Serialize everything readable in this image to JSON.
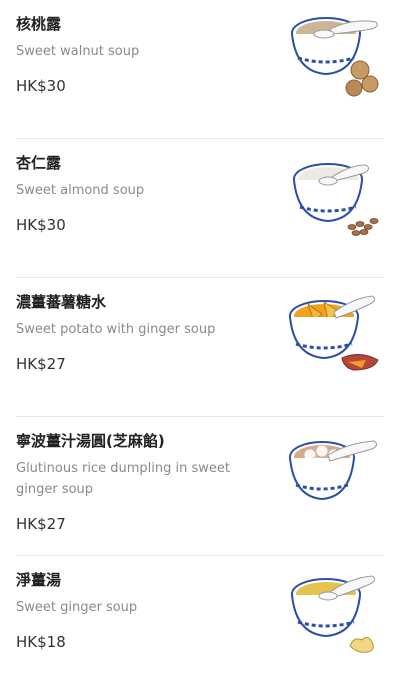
{
  "menu": {
    "items": [
      {
        "name": "核桃露",
        "desc": "Sweet walnut soup",
        "price": "HK$30",
        "soup_color": "#cdb696",
        "garnish": "walnut-icon"
      },
      {
        "name": "杏仁露",
        "desc": "Sweet almond soup",
        "price": "HK$30",
        "soup_color": "#efe9e3",
        "garnish": "almond-icon"
      },
      {
        "name": "濃薑蕃薯糖水",
        "desc": "Sweet potato with ginger soup",
        "price": "HK$27",
        "soup_color": "#f1a31f",
        "garnish": "sweet-potato-icon"
      },
      {
        "name": "寧波薑汁湯圓(芝麻餡)",
        "desc": "Glutinous rice dumpling in sweet ginger soup",
        "price": "HK$27",
        "soup_color": "#d9a98c",
        "garnish": "dumpling-icon"
      },
      {
        "name": "淨薑湯",
        "desc": "Sweet ginger soup",
        "price": "HK$18",
        "soup_color": "#e6c24e",
        "garnish": "ginger-icon"
      }
    ]
  }
}
